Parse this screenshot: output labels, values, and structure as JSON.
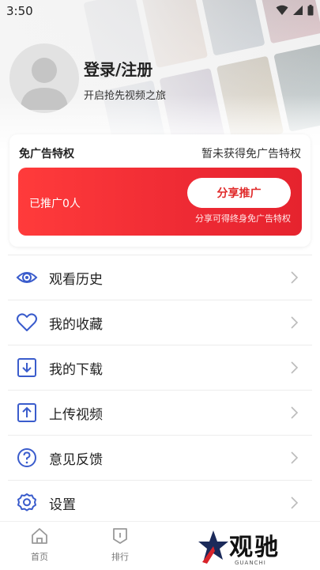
{
  "status_bar": {
    "time": "3:50"
  },
  "profile": {
    "login_title": "登录/注册",
    "login_subtitle": "开启抢先视频之旅"
  },
  "ad_card": {
    "title": "免广告特权",
    "status": "暂未获得免广告特权",
    "promoted_text": "已推广0人",
    "share_button": "分享推广",
    "hint": "分享可得终身免广告特权"
  },
  "menu": {
    "items": [
      {
        "label": "观看历史",
        "icon": "eye-icon"
      },
      {
        "label": "我的收藏",
        "icon": "heart-icon"
      },
      {
        "label": "我的下载",
        "icon": "download-icon"
      },
      {
        "label": "上传视频",
        "icon": "upload-icon"
      },
      {
        "label": "意见反馈",
        "icon": "feedback-icon"
      },
      {
        "label": "设置",
        "icon": "gear-icon"
      }
    ]
  },
  "tab_bar": {
    "tabs": [
      {
        "label": "首页"
      },
      {
        "label": "排行"
      }
    ]
  },
  "watermark": {
    "brand": "观驰",
    "sub": "GUANCHI"
  },
  "colors": {
    "accent_red": "#e6232e",
    "icon_blue": "#3a5ccc"
  }
}
